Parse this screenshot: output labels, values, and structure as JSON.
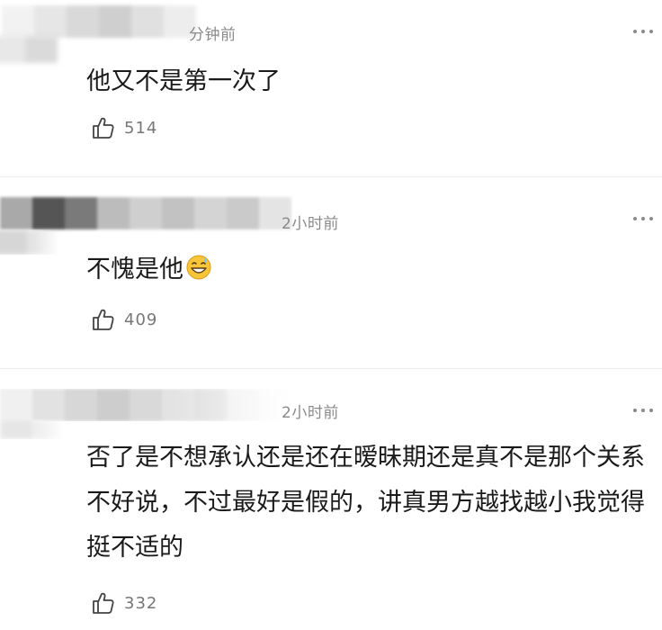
{
  "comments": [
    {
      "time": "分钟前",
      "text": "他又不是第一次了",
      "likes": "514"
    },
    {
      "time": "2小时前",
      "text": "不愧是他",
      "emoji_icon": "grin-sweat-emoji",
      "likes": "409"
    },
    {
      "time": "2小时前",
      "text": "否了是不想承认还是还在暧昧期还是真不是那个关系不好说，不过最好是假的，讲真男方越找越小我觉得挺不适的",
      "likes": "332"
    }
  ],
  "icons": {
    "like": "thumbs-up-outline-icon",
    "more": "more-dots-icon"
  },
  "colors": {
    "text": "#1a1a1a",
    "meta": "#8a8a8a",
    "divider": "#ececec"
  }
}
